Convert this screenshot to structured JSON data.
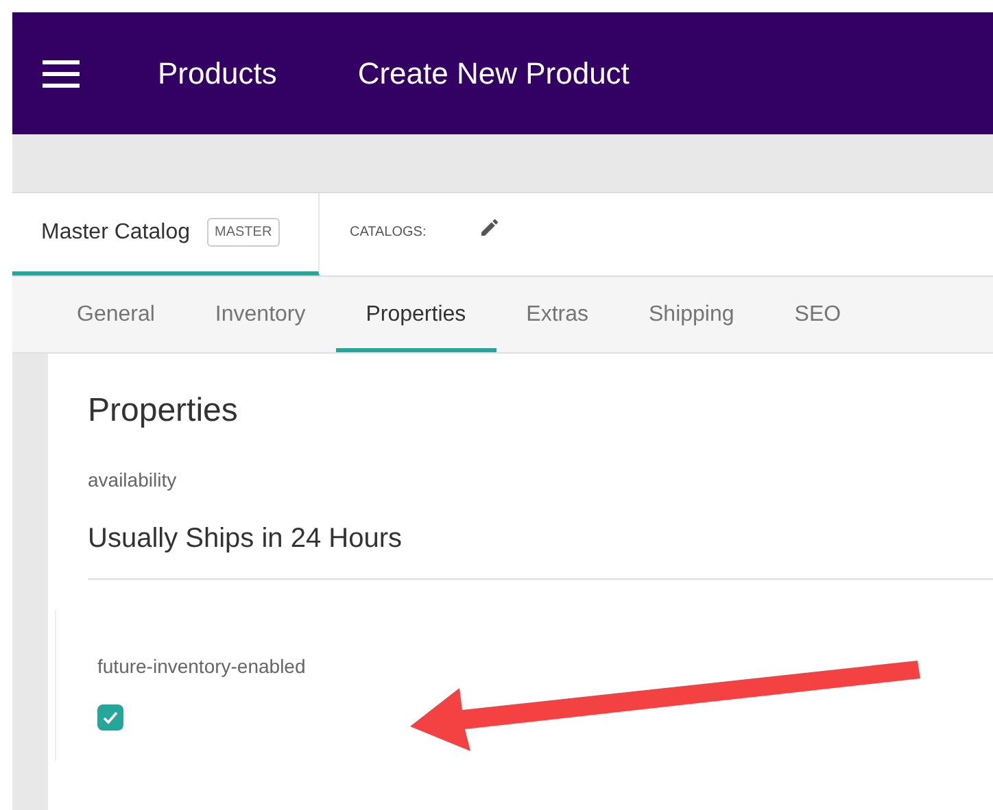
{
  "header": {
    "breadcrumbs": [
      "Products",
      "Create New Product"
    ]
  },
  "catalog_bar": {
    "catalog": {
      "name": "Master Catalog",
      "badge": "MASTER",
      "selected": true
    },
    "catalogs_label": "CATALOGS:"
  },
  "tabs": [
    {
      "label": "General",
      "selected": false
    },
    {
      "label": "Inventory",
      "selected": false
    },
    {
      "label": "Properties",
      "selected": true
    },
    {
      "label": "Extras",
      "selected": false
    },
    {
      "label": "Shipping",
      "selected": false
    },
    {
      "label": "SEO",
      "selected": false
    }
  ],
  "panel": {
    "title": "Properties",
    "fields": [
      {
        "kind": "text",
        "label": "availability",
        "value": "Usually Ships in 24 Hours"
      },
      {
        "kind": "checkbox",
        "label": "future-inventory-enabled",
        "checked": true
      }
    ]
  }
}
